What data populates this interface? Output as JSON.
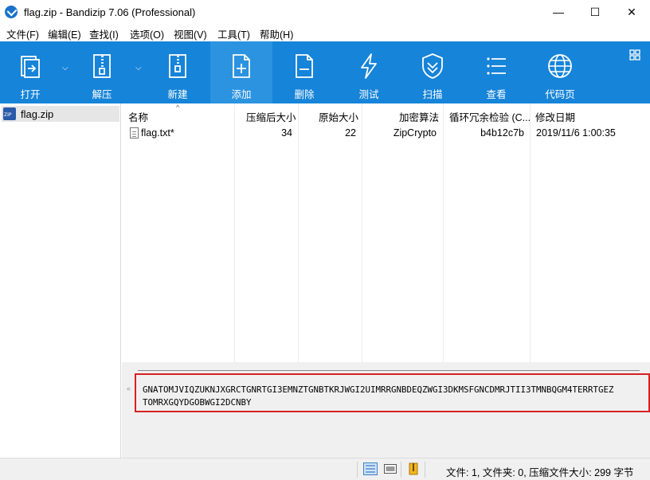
{
  "window": {
    "title": "flag.zip - Bandizip 7.06 (Professional)",
    "minimize": "—",
    "maximize": "☐",
    "close": "✕"
  },
  "menu": [
    "文件(F)",
    "编辑(E)",
    "查找(I)",
    "选项(O)",
    "视图(V)",
    "工具(T)",
    "帮助(H)"
  ],
  "toolbar": {
    "open": "打开",
    "extract": "解压",
    "new": "新建",
    "add": "添加",
    "delete": "删除",
    "test": "测试",
    "scan": "扫描",
    "view": "查看",
    "codepage": "代码页"
  },
  "tree": {
    "item": "flag.zip"
  },
  "columns": {
    "name": "名称",
    "compressed": "压缩后大小",
    "original": "原始大小",
    "encryption": "加密算法",
    "crc": "循环冗余检验 (C...",
    "modified": "修改日期"
  },
  "files": [
    {
      "name": "flag.txt*",
      "compressed": "34",
      "original": "22",
      "encryption": "ZipCrypto",
      "crc": "b4b12c7b",
      "modified": "2019/11/6 1:00:35"
    }
  ],
  "comment": {
    "line1": "GNATOMJVIQZUKNJXGRCTGNRTGI3EMNZTGNBTKRJWGI2UIMRRGNBDEQZWGI3DKMSFGNCDMRJTII3TMNBQGM4TERRTGEZ",
    "line2": "TOMRXGQYDGOBWGI2DCNBY"
  },
  "status": {
    "text": "文件: 1, 文件夹: 0, 压缩文件大小: 299 字节"
  },
  "colors": {
    "toolbar": "#1684d8",
    "highlight": "#d62020"
  }
}
